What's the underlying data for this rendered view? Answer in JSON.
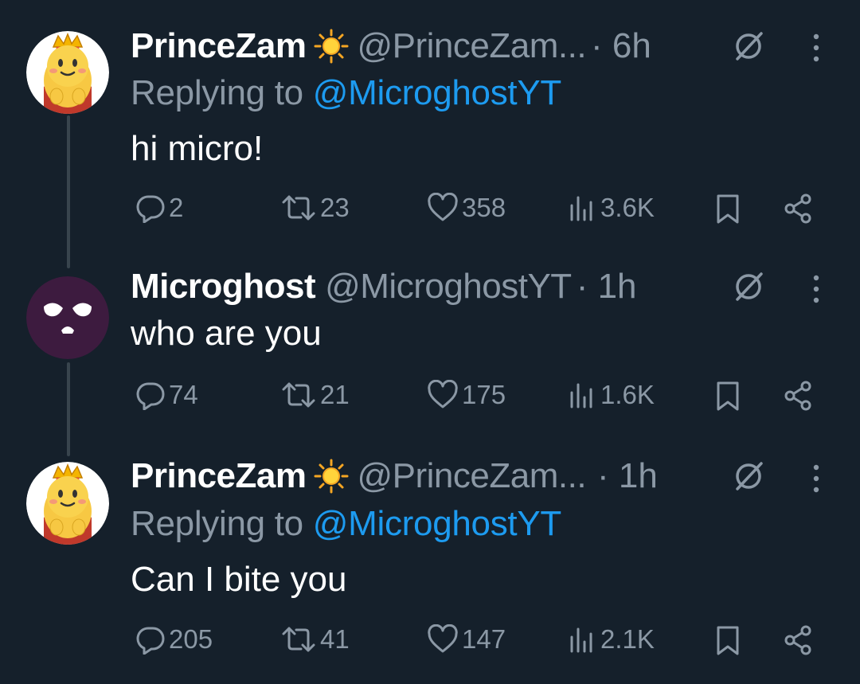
{
  "tweets": [
    {
      "name": "PrinceZam",
      "handle": "@PrinceZam...",
      "time": "· 6h",
      "replying_prefix": "Replying to",
      "replying_to": "@MicroghostYT",
      "text": "hi micro!",
      "replies": "2",
      "retweets": "23",
      "likes": "358",
      "views": "3.6K",
      "avatar_icon": "crowned-bear-avatar"
    },
    {
      "name": "Microghost",
      "handle": "@MicroghostYT",
      "time": "· 1h",
      "text": "who are you",
      "replies": "74",
      "retweets": "21",
      "likes": "175",
      "views": "1.6K",
      "avatar_icon": "sad-ghost-avatar"
    },
    {
      "name": "PrinceZam",
      "handle": "@PrinceZam...",
      "time": "· 1h",
      "replying_prefix": "Replying to",
      "replying_to": "@MicroghostYT",
      "text": "Can I bite you",
      "replies": "205",
      "retweets": "41",
      "likes": "147",
      "views": "2.1K",
      "avatar_icon": "crowned-bear-avatar"
    }
  ],
  "colors": {
    "background": "#15202b",
    "secondary_text": "#8b98a5",
    "mention": "#1d9bf0",
    "thread_line": "#38444d",
    "sun_badge": "#ffd43b"
  }
}
